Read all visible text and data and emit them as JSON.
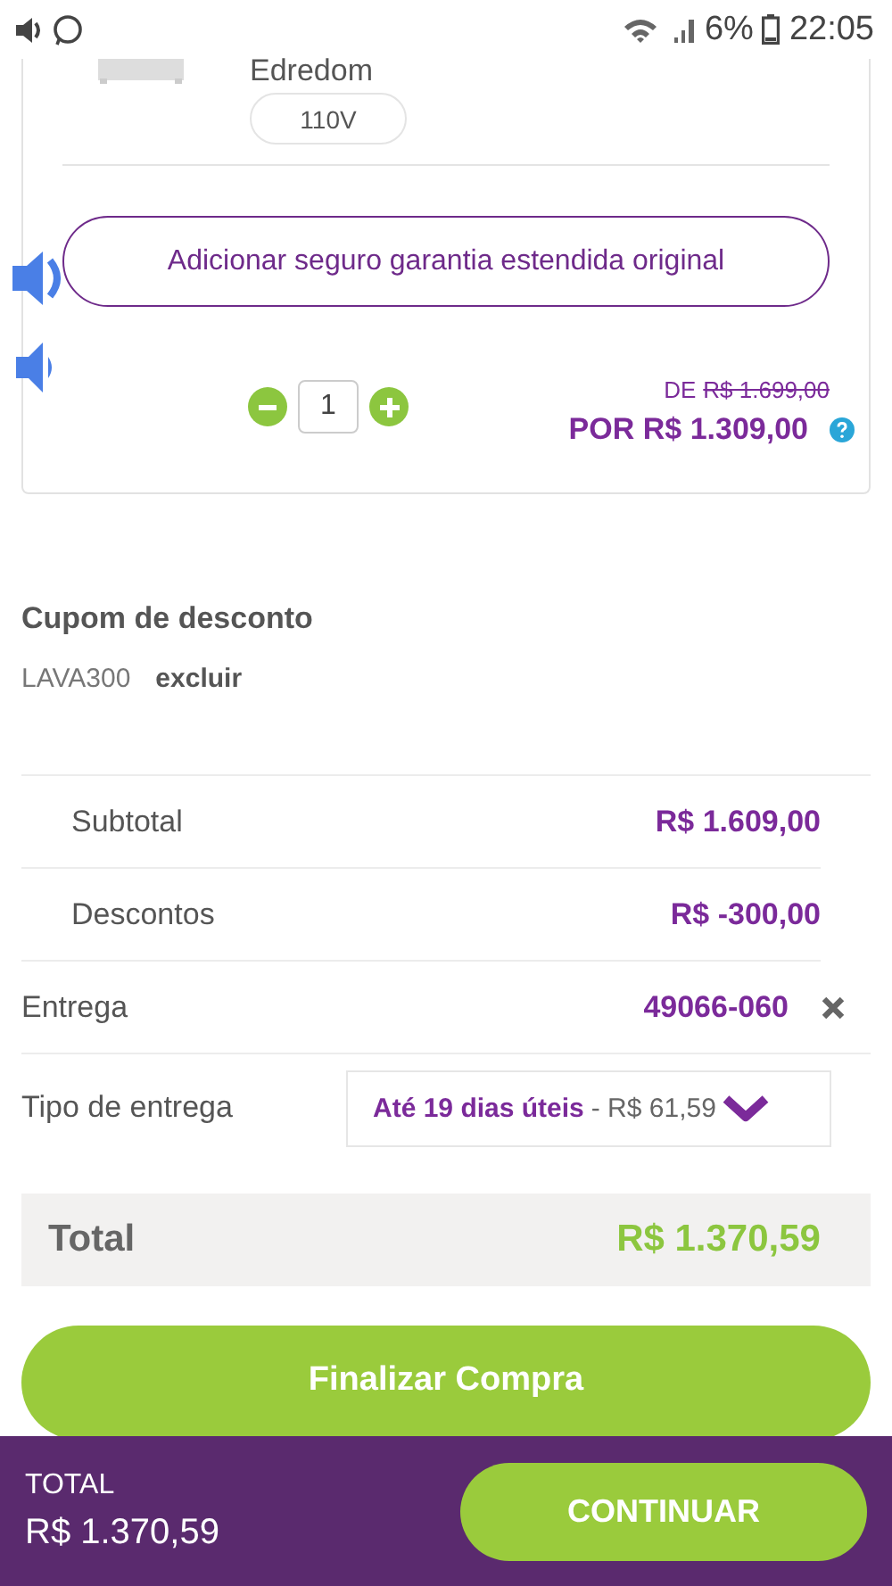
{
  "status_bar": {
    "battery": "6%",
    "time": "22:05"
  },
  "cart_item": {
    "name": "Edredom",
    "variant": "110V",
    "warranty_button": "Adicionar seguro garantia estendida original",
    "quantity": "1",
    "old_price_label": "DE",
    "old_price": "R$ 1.699,00",
    "price": "POR R$ 1.309,00"
  },
  "coupon": {
    "title": "Cupom de desconto",
    "code": "LAVA300",
    "remove": "excluir"
  },
  "summary_rows": [
    {
      "label": "Subtotal",
      "value": "R$ 1.609,00"
    },
    {
      "label": "Descontos",
      "value": "R$ -300,00"
    }
  ],
  "delivery": {
    "label": "Entrega",
    "cep": "49066-060"
  },
  "delivery_type": {
    "label": "Tipo de entrega",
    "option": "Até 19 dias úteis",
    "price": "- R$ 61,59"
  },
  "total": {
    "label": "Total",
    "value": "R$ 1.370,59"
  },
  "finalize_button": "Finalizar Compra",
  "bottom_bar": {
    "label": "TOTAL",
    "value": "R$ 1.370,59",
    "button": "CONTINUAR"
  }
}
